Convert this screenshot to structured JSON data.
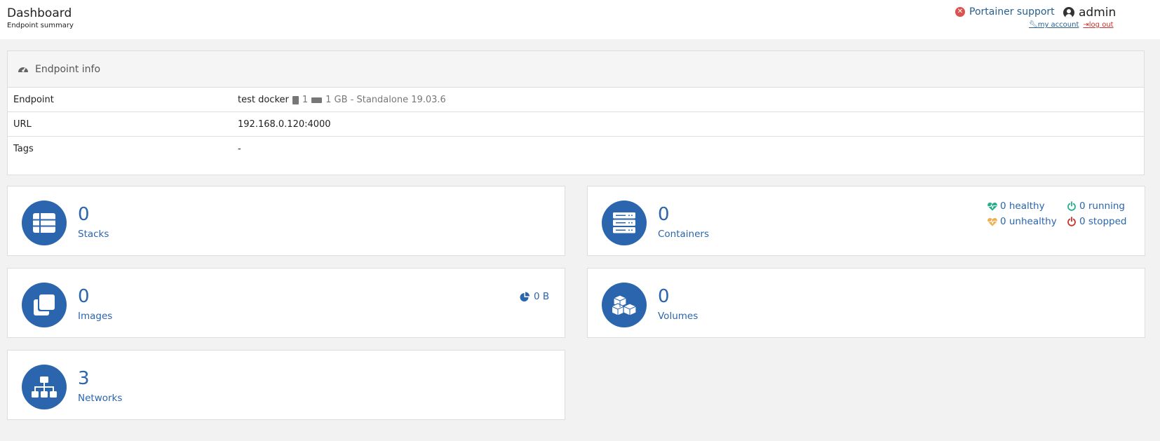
{
  "header": {
    "title": "Dashboard",
    "subtitle": "Endpoint summary",
    "support_label": "Portainer support",
    "support_icon": "x-circle-icon",
    "username": "admin",
    "my_account_label": "my account",
    "logout_label": "log out"
  },
  "endpoint_info": {
    "title": "Endpoint info",
    "rows": [
      {
        "label": "Endpoint",
        "value": "test docker",
        "cpu": "1",
        "meta": "1 GB - Standalone 19.03.6"
      },
      {
        "label": "URL",
        "value": "192.168.0.120:4000"
      },
      {
        "label": "Tags",
        "value": "-"
      }
    ]
  },
  "widgets": {
    "stacks": {
      "count": "0",
      "label": "Stacks",
      "icon": "list-icon"
    },
    "containers": {
      "count": "0",
      "label": "Containers",
      "icon": "server-icon",
      "healthy": "0 healthy",
      "running": "0 running",
      "unhealthy": "0 unhealthy",
      "stopped": "0 stopped"
    },
    "images": {
      "count": "0",
      "label": "Images",
      "icon": "clone-icon",
      "size": "0 B"
    },
    "volumes": {
      "count": "0",
      "label": "Volumes",
      "icon": "cubes-icon"
    },
    "networks": {
      "count": "3",
      "label": "Networks",
      "icon": "sitemap-icon"
    }
  },
  "colors": {
    "accent": "#2a65ad",
    "healthy": "#23ae89",
    "unhealthy": "#f0ad4e",
    "stopped": "#c9302c",
    "logout": "#c9302c"
  }
}
